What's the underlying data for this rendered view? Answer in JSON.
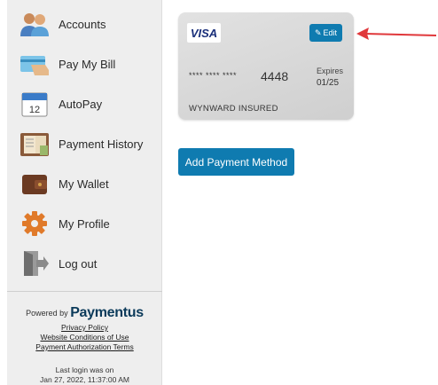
{
  "sidebar": {
    "items": [
      {
        "label": "Accounts",
        "icon": "accounts-icon"
      },
      {
        "label": "Pay My Bill",
        "icon": "pay-bill-icon"
      },
      {
        "label": "AutoPay",
        "icon": "calendar-icon"
      },
      {
        "label": "Payment History",
        "icon": "payment-history-icon"
      },
      {
        "label": "My Wallet",
        "icon": "wallet-icon"
      },
      {
        "label": "My Profile",
        "icon": "gear-icon"
      },
      {
        "label": "Log out",
        "icon": "logout-icon"
      }
    ],
    "calendar_day": "12",
    "powered_by": "Powered by",
    "brand": "Paymentus",
    "links": [
      "Privacy Policy",
      "Website Conditions of Use",
      "Payment Authorization Terms"
    ],
    "last_login_label": "Last login was on",
    "last_login_value": "Jan 27, 2022, 11:37:00 AM"
  },
  "card": {
    "brand": "VISA",
    "edit_label": "Edit",
    "masked_number": "**** **** ****",
    "last4": "4448",
    "expires_label": "Expires",
    "expires_value": "01/25",
    "holder": "WYNWARD INSURED"
  },
  "add_payment_label": "Add Payment Method",
  "colors": {
    "accent": "#0f7bb0",
    "sidebar_bg": "#eeeeee",
    "arrow": "#e0383b"
  }
}
